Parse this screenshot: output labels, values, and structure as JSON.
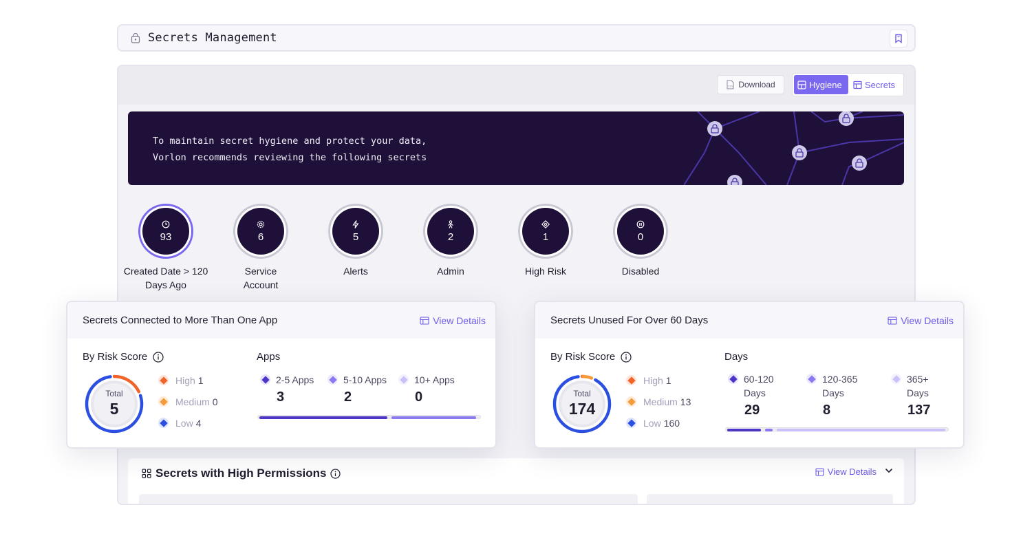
{
  "header": {
    "title": "Secrets Management",
    "icon": "lock-icon"
  },
  "toolbar": {
    "download_label": "Download",
    "hygiene_label": "Hygiene",
    "secrets_label": "Secrets"
  },
  "banner": {
    "line1": "To maintain secret hygiene and protect your data,",
    "line2": "Vorlon recommends reviewing the following secrets"
  },
  "kpis": [
    {
      "value": "93",
      "label": "Created Date > 120 Days Ago",
      "icon": "clock-icon"
    },
    {
      "value": "6",
      "label": "Service Account",
      "icon": "gear-icon"
    },
    {
      "value": "5",
      "label": "Alerts",
      "icon": "lightning-icon"
    },
    {
      "value": "2",
      "label": "Admin",
      "icon": "person-icon"
    },
    {
      "value": "1",
      "label": "High Risk",
      "icon": "target-icon"
    },
    {
      "value": "0",
      "label": "Disabled",
      "icon": "pause-icon"
    }
  ],
  "card_apps": {
    "title": "Secrets Connected to More Than One App",
    "view_details": "View Details",
    "risk_label": "By Risk Score",
    "total_label": "Total",
    "total": "5",
    "risk": [
      {
        "name": "High",
        "value": "1",
        "color": "#f0642a"
      },
      {
        "name": "Medium",
        "value": "0",
        "color": "#f59a3a"
      },
      {
        "name": "Low",
        "value": "4",
        "color": "#2b4fe0"
      }
    ],
    "group_label": "Apps",
    "groups": [
      {
        "name": "2-5 Apps",
        "value": "3",
        "fraction": 0.6,
        "color": "#4b36c8"
      },
      {
        "name": "5-10 Apps",
        "value": "2",
        "fraction": 0.4,
        "color": "#8a7af0"
      },
      {
        "name": "10+ Apps",
        "value": "0",
        "fraction": 0,
        "color": "#c9c2f8"
      }
    ]
  },
  "card_unused": {
    "title": "Secrets Unused For Over 60 Days",
    "view_details": "View Details",
    "risk_label": "By Risk Score",
    "total_label": "Total",
    "total": "174",
    "risk": [
      {
        "name": "High",
        "value": "1",
        "color": "#f0642a"
      },
      {
        "name": "Medium",
        "value": "13",
        "color": "#f59a3a"
      },
      {
        "name": "Low",
        "value": "160",
        "color": "#2b4fe0"
      }
    ],
    "group_label": "Days",
    "groups": [
      {
        "name": "60-120 Days",
        "value": "29",
        "fraction": 0.167,
        "color": "#4b36c8"
      },
      {
        "name": "120-365 Days",
        "value": "8",
        "fraction": 0.046,
        "color": "#8a7af0"
      },
      {
        "name": "365+ Days",
        "value": "137",
        "fraction": 0.787,
        "color": "#c9c2f8"
      }
    ]
  },
  "permissions": {
    "title": "Secrets with High Permissions",
    "view_details": "View Details"
  }
}
